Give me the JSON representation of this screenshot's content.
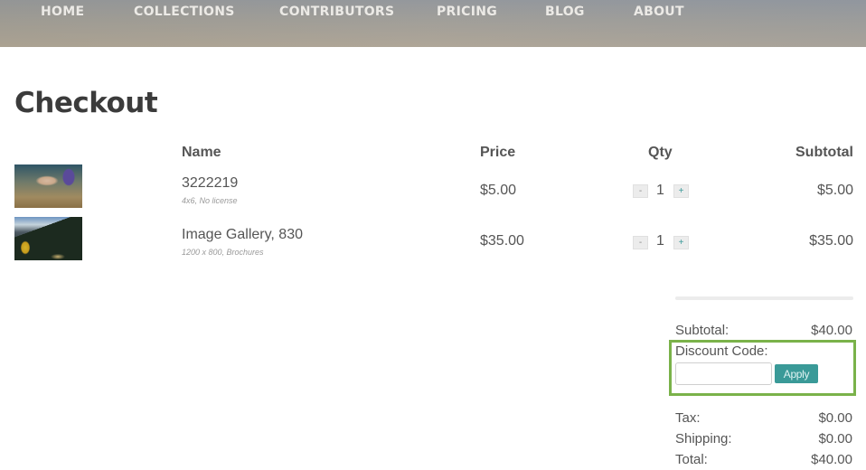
{
  "nav": {
    "items": [
      {
        "label": "HOME"
      },
      {
        "label": "COLLECTIONS"
      },
      {
        "label": "CONTRIBUTORS"
      },
      {
        "label": "PRICING"
      },
      {
        "label": "BLOG"
      },
      {
        "label": "ABOUT"
      }
    ]
  },
  "page": {
    "title": "Checkout"
  },
  "cart": {
    "columns": {
      "name": "Name",
      "price": "Price",
      "qty": "Qty",
      "subtotal": "Subtotal"
    },
    "items": [
      {
        "thumbnail": "underwater-swimmer-photo",
        "name": "3222219",
        "meta": "4x6, No license",
        "price": "$5.00",
        "qty": "1",
        "minus": "-",
        "plus": "+",
        "subtotal": "$5.00"
      },
      {
        "thumbnail": "mountain-landscape-photo",
        "name": "Image Gallery, 830",
        "meta": "1200 x 800, Brochures",
        "price": "$35.00",
        "qty": "1",
        "minus": "-",
        "plus": "+",
        "subtotal": "$35.00"
      }
    ]
  },
  "summary": {
    "subtotal_label": "Subtotal:",
    "subtotal_value": "$40.00",
    "discount_label": "Discount Code:",
    "discount_value": "",
    "discount_placeholder": "",
    "apply_label": "Apply",
    "tax_label": "Tax:",
    "tax_value": "$0.00",
    "shipping_label": "Shipping:",
    "shipping_value": "$0.00",
    "total_label": "Total:",
    "total_value": "$40.00"
  },
  "colors": {
    "accent_teal": "#3a9a98",
    "highlight_green": "#7ab24a",
    "title_text": "#3b3b3b",
    "body_text": "#555555"
  }
}
